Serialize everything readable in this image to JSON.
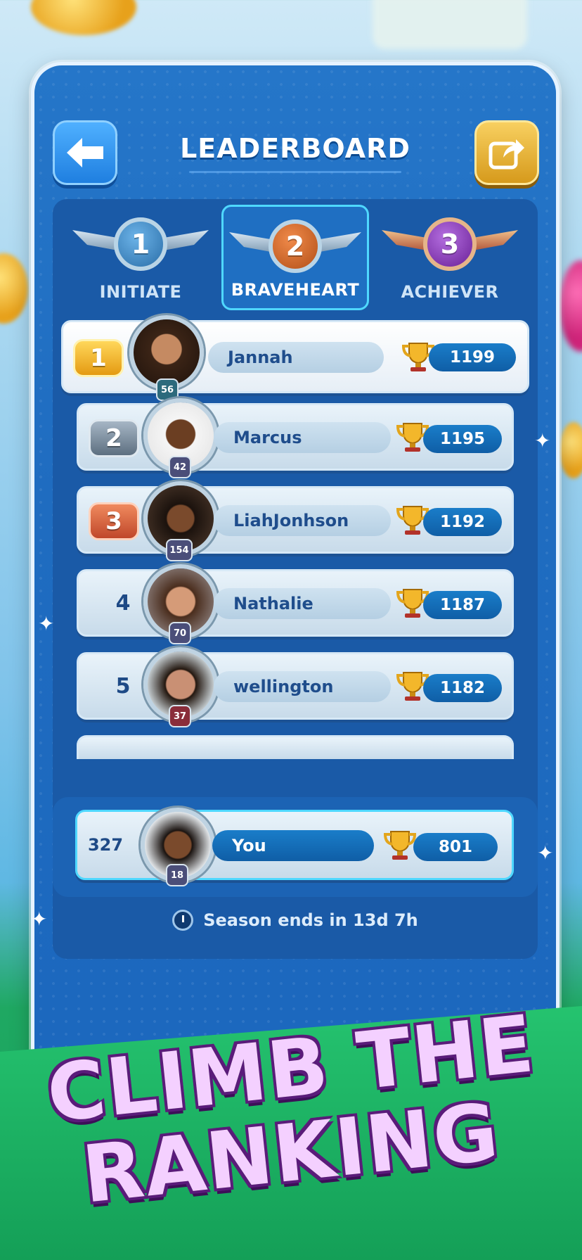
{
  "header": {
    "title": "LEADERBOARD"
  },
  "tiers": [
    {
      "number": "1",
      "label": "INITIATE",
      "color": "#3a86c0",
      "active": false
    },
    {
      "number": "2",
      "label": "BRAVEHEART",
      "color": "#d56b2c",
      "active": true
    },
    {
      "number": "3",
      "label": "ACHIEVER",
      "color": "#8a3bb8",
      "active": false
    }
  ],
  "rows": [
    {
      "rank": "1",
      "name": "Jannah",
      "level": "56",
      "score": "1199",
      "medal_color": "#f3b72b"
    },
    {
      "rank": "2",
      "name": "Marcus",
      "level": "42",
      "score": "1195",
      "medal_color": "#7f93a6"
    },
    {
      "rank": "3",
      "name": "LiahJonhson",
      "level": "154",
      "score": "1192",
      "medal_color": "#d9673a"
    },
    {
      "rank": "4",
      "name": "Nathalie",
      "level": "70",
      "score": "1187"
    },
    {
      "rank": "5",
      "name": "wellington",
      "level": "37",
      "score": "1182"
    }
  ],
  "you": {
    "rank": "327",
    "name": "You",
    "level": "18",
    "score": "801"
  },
  "season": {
    "text": "Season ends in 13d 7h"
  },
  "banner": {
    "line1": "CLIMB THE",
    "line2": "RANKING"
  },
  "icons": {
    "back": "arrow-left-icon",
    "share": "share-icon",
    "trophy": "trophy-icon",
    "clock": "clock-icon"
  }
}
